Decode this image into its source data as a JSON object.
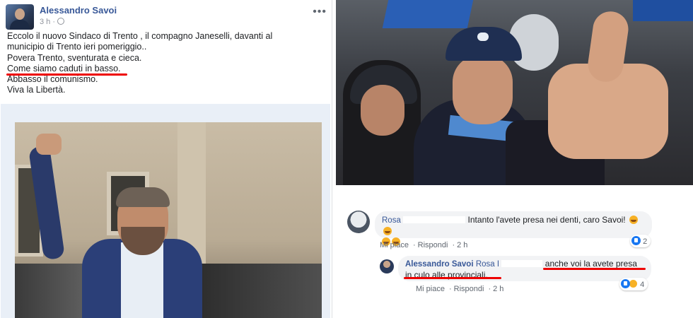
{
  "post": {
    "author": "Alessandro Savoi",
    "time": "3 h",
    "more": "•••",
    "lines": [
      "Eccolo il nuovo Sindaco di Trento , il compagno Janeselli, davanti al",
      "municipio di Trento ieri pomeriggio..",
      "Povera Trento, sventurata e cieca.",
      "Come siamo caduti in basso.",
      "Abbasso il comunismo.",
      "Viva la Libertà."
    ]
  },
  "comments": [
    {
      "name": "Rosa",
      "text": "Intanto l'avete presa nei denti, caro Savoi!",
      "like": "Mi piace",
      "reply": "Rispondi",
      "time": "2 h",
      "reactions": "2"
    },
    {
      "name": "Alessandro Savoi",
      "tag": "Rosa I",
      "text_a": "anche voi la avete presa",
      "text_b": "in culo alle provinciali.",
      "like": "Mi piace",
      "reply": "Rispondi",
      "time": "2 h",
      "reactions": "4"
    }
  ],
  "colors": {
    "link": "#385898",
    "underline": "#e00000",
    "bubble": "#f2f3f5"
  }
}
